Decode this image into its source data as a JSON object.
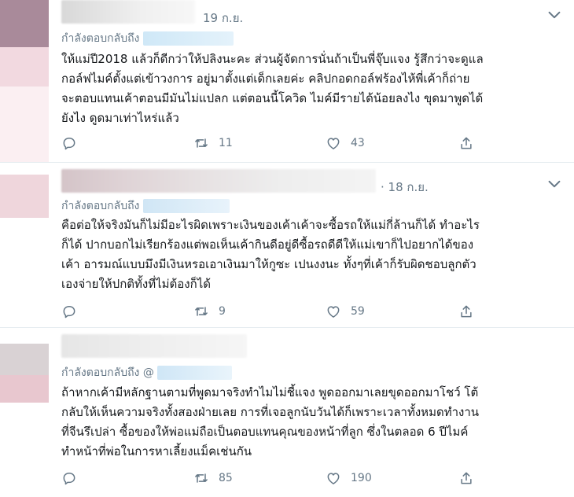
{
  "tweets": [
    {
      "date": "19 ก.ย.",
      "replying_label": "กำลังตอบกลับถึง",
      "body": "ให้แม่ปี2018 แล้วก็ดีกว่าให้ปลิงนะคะ ส่วนผู้จัดการนั่นถ้าเป็นพี่จุ๊บแจง รู้สึกว่าจะดูแล\nกอล์ฟไมค์ตั้งแต่เข้าวงการ อยู่มาตั้งแต่เด็กเลยค่ะ คลิปกอดกอล์ฟร้องไห้พี่เค้าก็ถ่าย\nจะตอบแทนเค้าตอนมีมันไม่แปลก แต่ตอนนี้โควิด ไมค์มีรายได้น้อยลงไง ขุดมาพูดได้\nยังไง ดูดมาเท่าไหร่แล้ว",
      "reply_count": "",
      "retweet_count": "11",
      "like_count": "43"
    },
    {
      "date": "· 18 ก.ย.",
      "replying_label": "กำลังตอบกลับถึง",
      "body": "คือต่อให้จริงมันก็ไม่มีอะไรผิดเพราะเงินของเค้าเค้าจะซื้อรถให้แม่กี่ล้านก็ได้ ทำอะไร\nก็ได้ ปากบอกไม่เรียกร้องแต่พอเห็นเค้ากินดีอยู่ดีซื้อรถดีดีให้แม่เขาก็ไปอยากได้ของ\nเค้า อารมณ์แบบมึงมีเงินหรอเอาเงินมาให้กูซะ เปนงงนะ ทั้งๆที่เค้าก็รับผิดชอบลูกตัว\nเองจ่ายให้ปกติทั้งที่ไม่ต้องก็ได้",
      "reply_count": "",
      "retweet_count": "9",
      "like_count": "59"
    },
    {
      "date": "",
      "replying_label": "กำลังตอบกลับถึง @",
      "body": "ถ้าหากเค้ามีหลักฐานตามที่พูดมาจริงทำไมไม่ชี้แจง พูดออกมาเลยขุดออกมาโชว์ โต้\nกลับให้เห็นความจริงทั้งสองฝ่ายเลย การที่เจอลูกนับวันได้ก็เพราะเวลาทั้งหมดทำงาน\nที่จีนรึเปล่า ซื้อของให้พ่อแม่ถือเป็นตอบแทนคุณของหน้าที่ลูก ซึ่งในตลอด 6 ปีไมค์\nทำหน้าที่พ่อในการหาเลี้ยงแม็คเช่นกัน",
      "reply_count": "",
      "retweet_count": "85",
      "like_count": "190"
    }
  ],
  "icons": {
    "reply": "reply-icon",
    "retweet": "retweet-icon",
    "like": "like-icon",
    "share": "share-icon",
    "caret": "chevron-down-icon"
  },
  "colors": {
    "text": "#14171a",
    "muted": "#657786",
    "divider": "#e6ecf0"
  }
}
